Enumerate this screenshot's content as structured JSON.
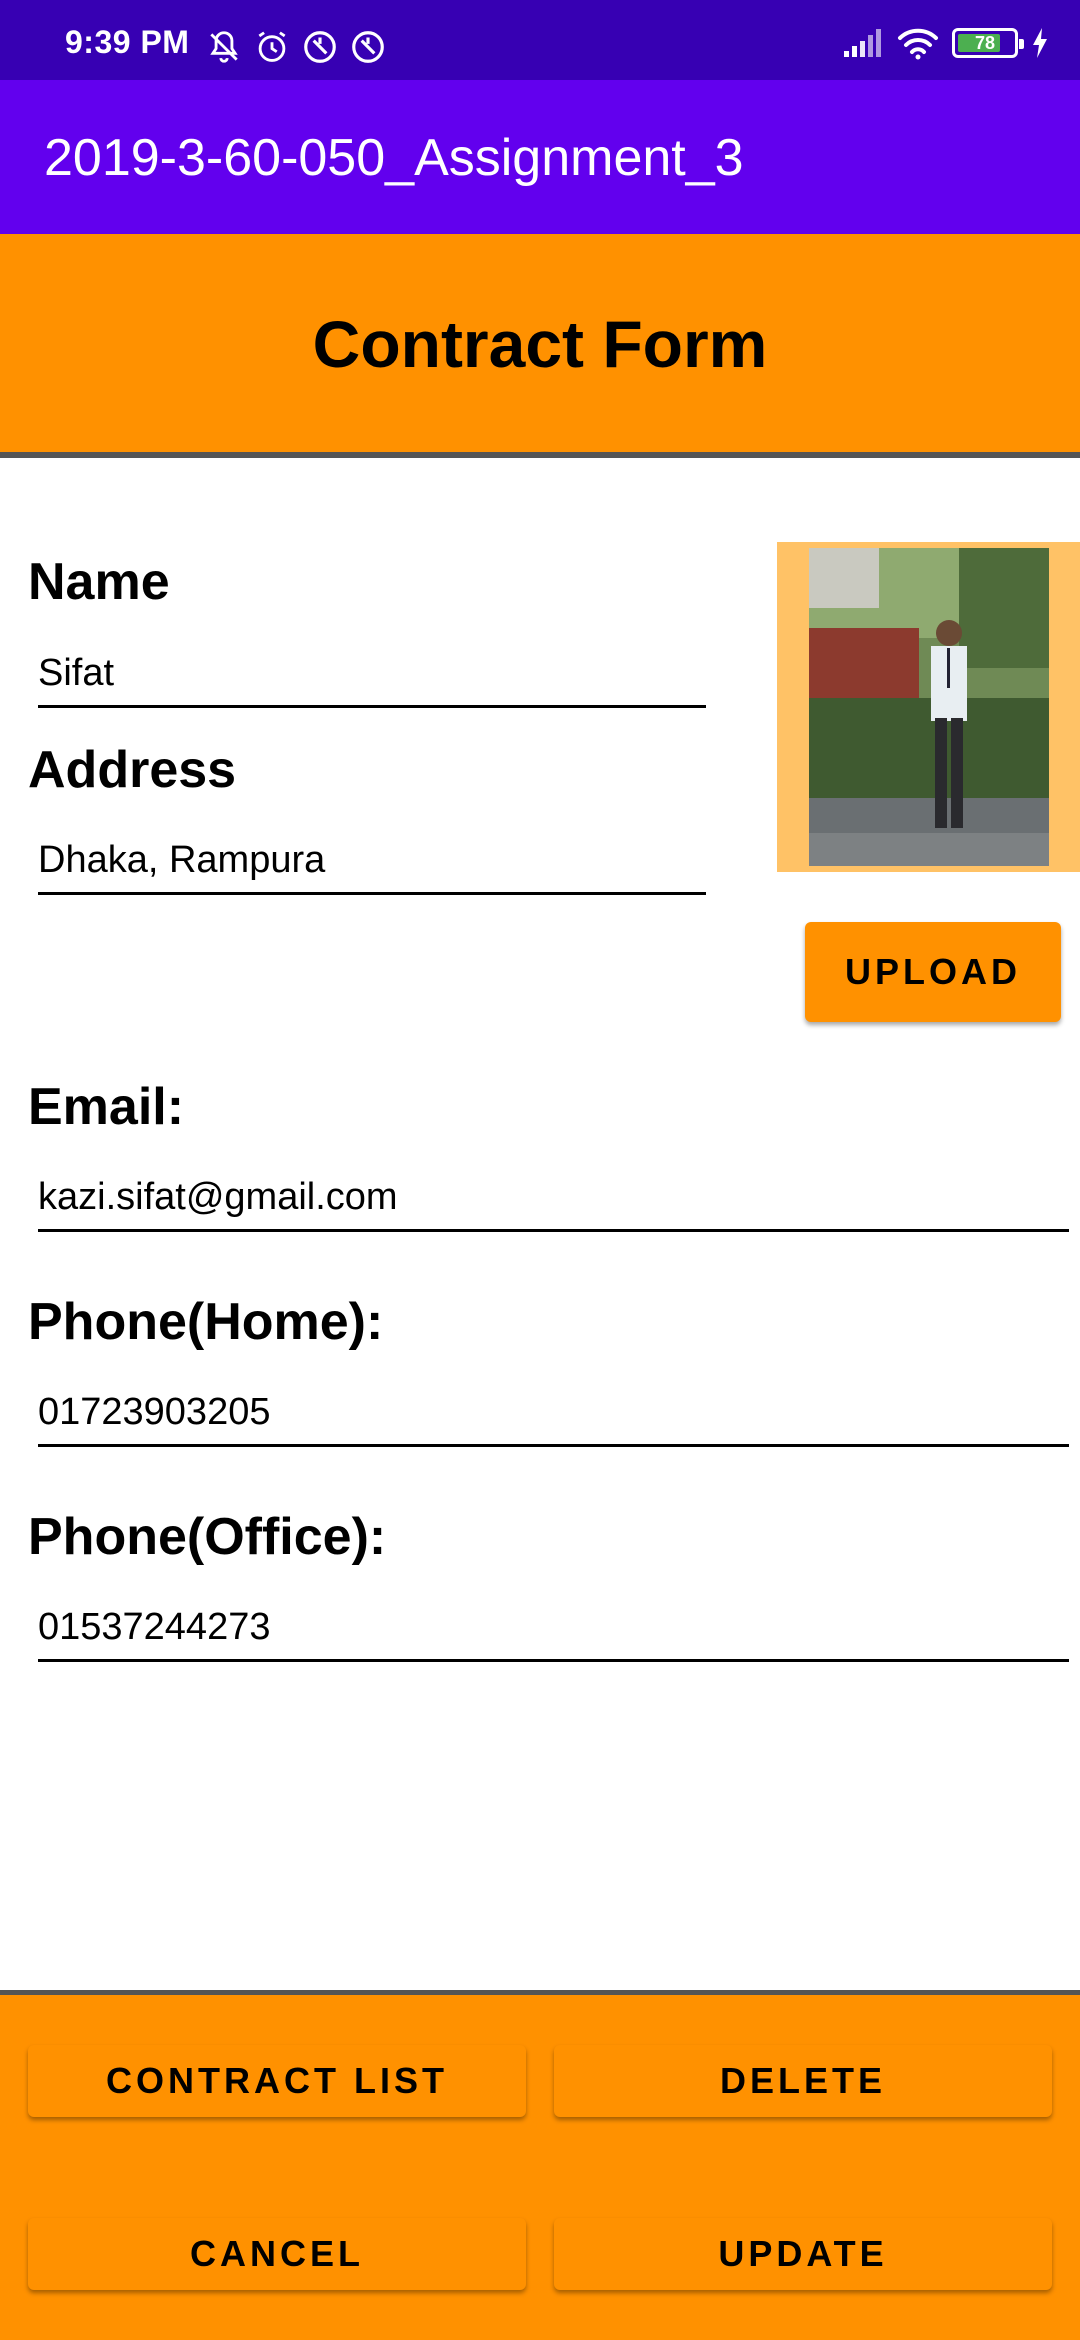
{
  "status_bar": {
    "time": "9:39 PM",
    "battery": "78",
    "battery_level_percent": 78,
    "left_icons": [
      "bell-off-icon",
      "alarm-icon",
      "data-saver-icon",
      "data-saver-icon"
    ],
    "right_icons": [
      "signal-icon",
      "wifi-icon",
      "battery-icon",
      "charging-icon"
    ]
  },
  "app_bar": {
    "title": "2019-3-60-050_Assignment_3"
  },
  "header": {
    "title": "Contract Form"
  },
  "form": {
    "name_label": "Name",
    "name_value": "Sifat",
    "address_label": "Address",
    "address_value": "Dhaka, Rampura",
    "email_label": "Email:",
    "email_value": "kazi.sifat@gmail.com",
    "phone_home_label": "Phone(Home):",
    "phone_home_value": "01723903205",
    "phone_office_label": "Phone(Office):",
    "phone_office_value": "01537244273"
  },
  "buttons": {
    "upload": "UPLOAD",
    "contract_list": "CONTRACT LIST",
    "delete": "DELETE",
    "cancel": "CANCEL",
    "update": "UPDATE"
  },
  "colors": {
    "status_bar": "#3700b3",
    "app_bar": "#6200ee",
    "accent": "#ff9100"
  }
}
